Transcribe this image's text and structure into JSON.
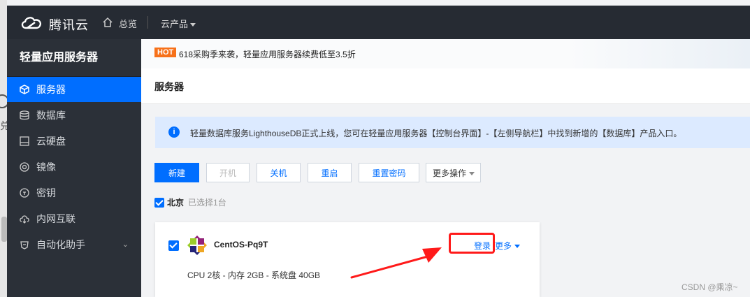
{
  "topbar": {
    "brand": "腾讯云",
    "overview": "总览",
    "products": "云产品"
  },
  "sidebar": {
    "title": "轻量应用服务器",
    "items": [
      {
        "label": "服务器",
        "icon": "server-icon",
        "active": true
      },
      {
        "label": "数据库",
        "icon": "database-icon"
      },
      {
        "label": "云硬盘",
        "icon": "disk-icon"
      },
      {
        "label": "镜像",
        "icon": "image-icon"
      },
      {
        "label": "密钥",
        "icon": "key-icon"
      },
      {
        "label": "内网互联",
        "icon": "network-icon"
      },
      {
        "label": "自动化助手",
        "icon": "automation-icon",
        "has_submenu": true
      }
    ]
  },
  "left_strip": {
    "text": "兑"
  },
  "banner": {
    "badge": "HOT",
    "text": "618采购季来袭，轻量应用服务器续费低至3.5折"
  },
  "page": {
    "title": "服务器"
  },
  "notice": {
    "text": "轻量数据库服务LighthouseDB正式上线，您可在轻量应用服务器【控制台界面】-【左侧导航栏】中找到新增的【数据库】产品入口。"
  },
  "toolbar": {
    "new": "新建",
    "start": "开机",
    "stop": "关机",
    "restart": "重启",
    "reset_password": "重置密码",
    "more_ops": "更多操作"
  },
  "region": {
    "name": "北京",
    "selected": "已选择1台"
  },
  "server": {
    "name": "CentOS-Pq9T",
    "login": "登录",
    "more": "更多",
    "spec": "CPU 2核 - 内存 2GB - 系统盘 40GB"
  },
  "watermark": "CSDN @乘凉~",
  "colors": {
    "accent": "#006eff",
    "hot": "#f7711a",
    "annotation": "#ff1a1a",
    "topbar_bg": "#262b33",
    "sidebar_bg": "#2b3038"
  }
}
